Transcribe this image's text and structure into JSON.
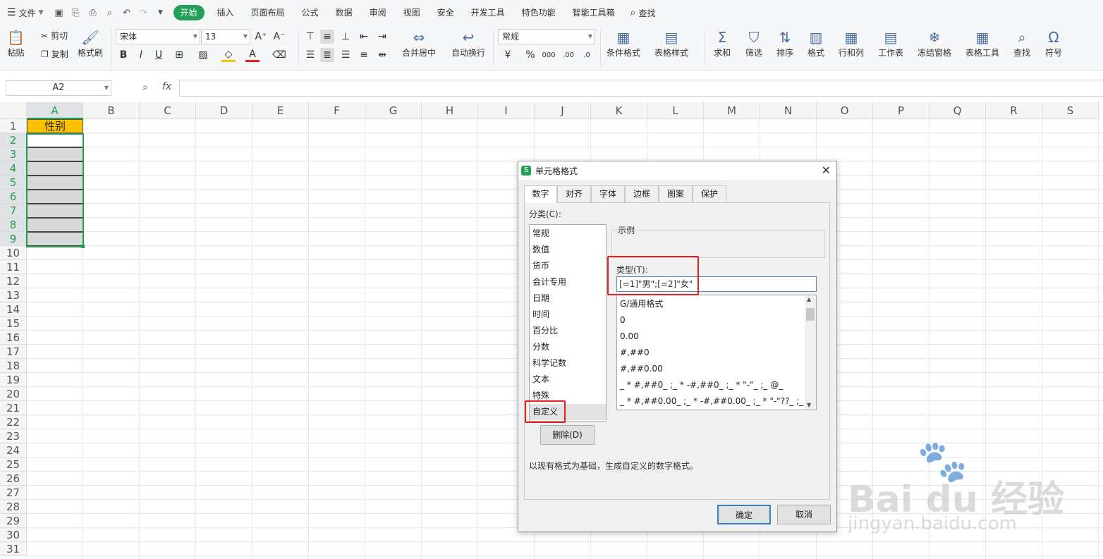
{
  "menubar": {
    "file": "文件",
    "tabs": [
      "开始",
      "插入",
      "页面布局",
      "公式",
      "数据",
      "审阅",
      "视图",
      "安全",
      "开发工具",
      "特色功能",
      "智能工具箱"
    ],
    "search": "查找"
  },
  "ribbon": {
    "paste": "粘贴",
    "cut": "剪切",
    "copy": "复制",
    "format_painter": "格式刷",
    "font_name": "宋体",
    "font_size": "13",
    "merge_center": "合并居中",
    "auto_wrap": "自动换行",
    "number_format": "常规",
    "cond_format": "条件格式",
    "table_style": "表格样式",
    "sum": "求和",
    "filter": "筛选",
    "sort": "排序",
    "format": "格式",
    "row_col": "行和列",
    "worksheet": "工作表",
    "freeze": "冻结窗格",
    "table_tools": "表格工具",
    "find": "查找",
    "symbol": "符号"
  },
  "formula": {
    "name_box": "A2",
    "fx": "fx"
  },
  "sheet": {
    "columns": [
      "A",
      "B",
      "C",
      "D",
      "E",
      "F",
      "G",
      "H",
      "I",
      "J",
      "K",
      "L",
      "M",
      "N",
      "O",
      "P",
      "Q",
      "R",
      "S"
    ],
    "rows": [
      "1",
      "2",
      "3",
      "4",
      "5",
      "6",
      "7",
      "8",
      "9",
      "10",
      "11",
      "12",
      "13",
      "14",
      "15",
      "16",
      "17",
      "18",
      "19",
      "20",
      "21",
      "22",
      "23",
      "24",
      "25",
      "26",
      "27",
      "28",
      "29",
      "30",
      "31"
    ],
    "a1": "性别"
  },
  "dialog": {
    "title": "单元格格式",
    "tabs": [
      "数字",
      "对齐",
      "字体",
      "边框",
      "图案",
      "保护"
    ],
    "category_label": "分类(C):",
    "categories": [
      "常规",
      "数值",
      "货币",
      "会计专用",
      "日期",
      "时间",
      "百分比",
      "分数",
      "科学记数",
      "文本",
      "特殊",
      "自定义"
    ],
    "sample_label": "示例",
    "type_label": "类型(T):",
    "type_value": "[=1]\"男\";[=2]\"女\"",
    "formats": [
      "G/通用格式",
      "0",
      "0.00",
      "#,##0",
      "#,##0.00",
      "_ * #,##0_ ;_ * -#,##0_ ;_ * \"-\"_ ;_ @_",
      "_ * #,##0.00_ ;_ * -#,##0.00_ ;_ * \"-\"??_ ;_ @_"
    ],
    "delete": "删除(D)",
    "description": "以现有格式为基础，生成自定义的数字格式。",
    "ok": "确定",
    "cancel": "取消"
  },
  "watermark": {
    "brand": "Bai du 经验",
    "url": "jingyan.baidu.com"
  },
  "colors": {
    "accent": "#22a05a",
    "header_fill": "#ffc000",
    "selection": "#21a04b",
    "highlight": "#e52020"
  }
}
